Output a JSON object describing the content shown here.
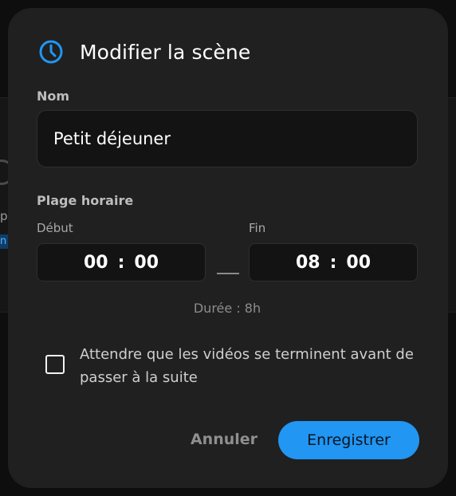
{
  "colors": {
    "accent": "#2196f3",
    "dialog_bg": "#202020",
    "field_bg": "#131313"
  },
  "background": {
    "fragment_text": "p",
    "fragment_badge": "n"
  },
  "dialog": {
    "title": "Modifier la scène",
    "title_icon": "clock-icon",
    "name_label": "Nom",
    "name_value": "Petit déjeuner",
    "range_label": "Plage horaire",
    "start_label": "Début",
    "end_label": "Fin",
    "start_time": {
      "hours": "00",
      "separator": ":",
      "minutes": "00"
    },
    "end_time": {
      "hours": "08",
      "separator": ":",
      "minutes": "00"
    },
    "duration": "Durée : 8h",
    "checkbox": {
      "checked": false,
      "label": "Attendre que les vidéos se terminent avant de passer à la suite"
    },
    "cancel_label": "Annuler",
    "save_label": "Enregistrer"
  }
}
